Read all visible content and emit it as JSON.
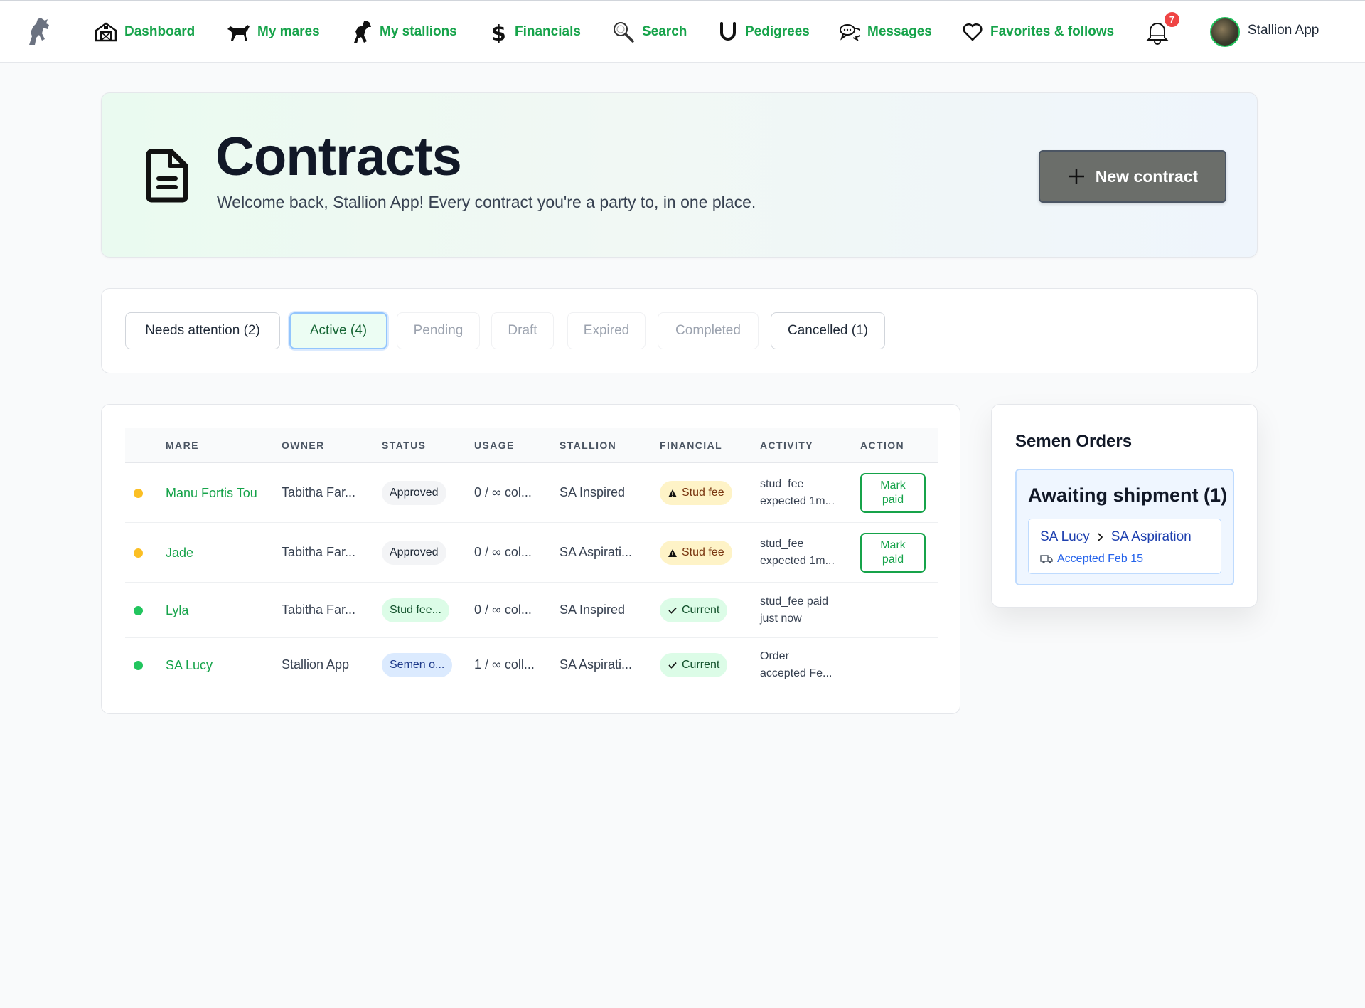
{
  "nav": {
    "items": [
      {
        "label": "Dashboard",
        "icon": "barn-icon"
      },
      {
        "label": "My mares",
        "icon": "horse-icon"
      },
      {
        "label": "My stallions",
        "icon": "rearing-horse-icon"
      },
      {
        "label": "Financials",
        "icon": "dollar-icon"
      },
      {
        "label": "Search",
        "icon": "search-icon"
      },
      {
        "label": "Pedigrees",
        "icon": "horseshoe-icon"
      },
      {
        "label": "Messages",
        "icon": "chat-icon"
      },
      {
        "label": "Favorites & follows",
        "icon": "heart-icon"
      }
    ],
    "notification_count": "7",
    "user_name": "Stallion App",
    "accent_color": "#16a34a"
  },
  "hero": {
    "title": "Contracts",
    "subtitle": "Welcome back, Stallion App! Every contract you're a party to, in one place.",
    "new_button_label": "New contract"
  },
  "filters": [
    {
      "label": "Needs attention (2)",
      "state": "enabled"
    },
    {
      "label": "Active (4)",
      "state": "selected"
    },
    {
      "label": "Pending",
      "state": "disabled"
    },
    {
      "label": "Draft",
      "state": "disabled"
    },
    {
      "label": "Expired",
      "state": "disabled"
    },
    {
      "label": "Completed",
      "state": "disabled"
    },
    {
      "label": "Cancelled (1)",
      "state": "enabled"
    }
  ],
  "table": {
    "columns": [
      "MARE",
      "OWNER",
      "STATUS",
      "USAGE",
      "STALLION",
      "FINANCIAL",
      "ACTIVITY",
      "ACTION"
    ],
    "rows": [
      {
        "dot": "#fbbf24",
        "mare": "Manu Fortis Tou",
        "owner": "Tabitha Far...",
        "status": "Approved",
        "status_style": "gray",
        "usage": "0 / ∞ col...",
        "stallion": "SA Inspired",
        "financial": "Stud fee",
        "financial_style": "warning",
        "activity_1": "stud_fee",
        "activity_2": "expected 1m...",
        "action": "Mark paid"
      },
      {
        "dot": "#fbbf24",
        "mare": "Jade",
        "owner": "Tabitha Far...",
        "status": "Approved",
        "status_style": "gray",
        "usage": "0 / ∞ col...",
        "stallion": "SA Aspirati...",
        "financial": "Stud fee",
        "financial_style": "warning",
        "activity_1": "stud_fee",
        "activity_2": "expected 1m...",
        "action": "Mark paid"
      },
      {
        "dot": "#22c55e",
        "mare": "Lyla",
        "owner": "Tabitha Far...",
        "status": "Stud fee...",
        "status_style": "green",
        "usage": "0 / ∞ col...",
        "stallion": "SA Inspired",
        "financial": "Current",
        "financial_style": "current",
        "activity_1": "stud_fee paid",
        "activity_2": "just now",
        "action": ""
      },
      {
        "dot": "#22c55e",
        "mare": "SA Lucy",
        "owner": "Stallion App",
        "status": "Semen o...",
        "status_style": "blue",
        "usage": "1 / ∞ coll...",
        "stallion": "SA Aspirati...",
        "financial": "Current",
        "financial_style": "current",
        "activity_1": "Order",
        "activity_2": "accepted Fe...",
        "action": ""
      }
    ]
  },
  "orders": {
    "title": "Semen Orders",
    "group_title": "Awaiting shipment (1)",
    "items": [
      {
        "mare": "SA Lucy",
        "stallion": "SA Aspiration",
        "date": "Accepted Feb 15"
      }
    ]
  }
}
